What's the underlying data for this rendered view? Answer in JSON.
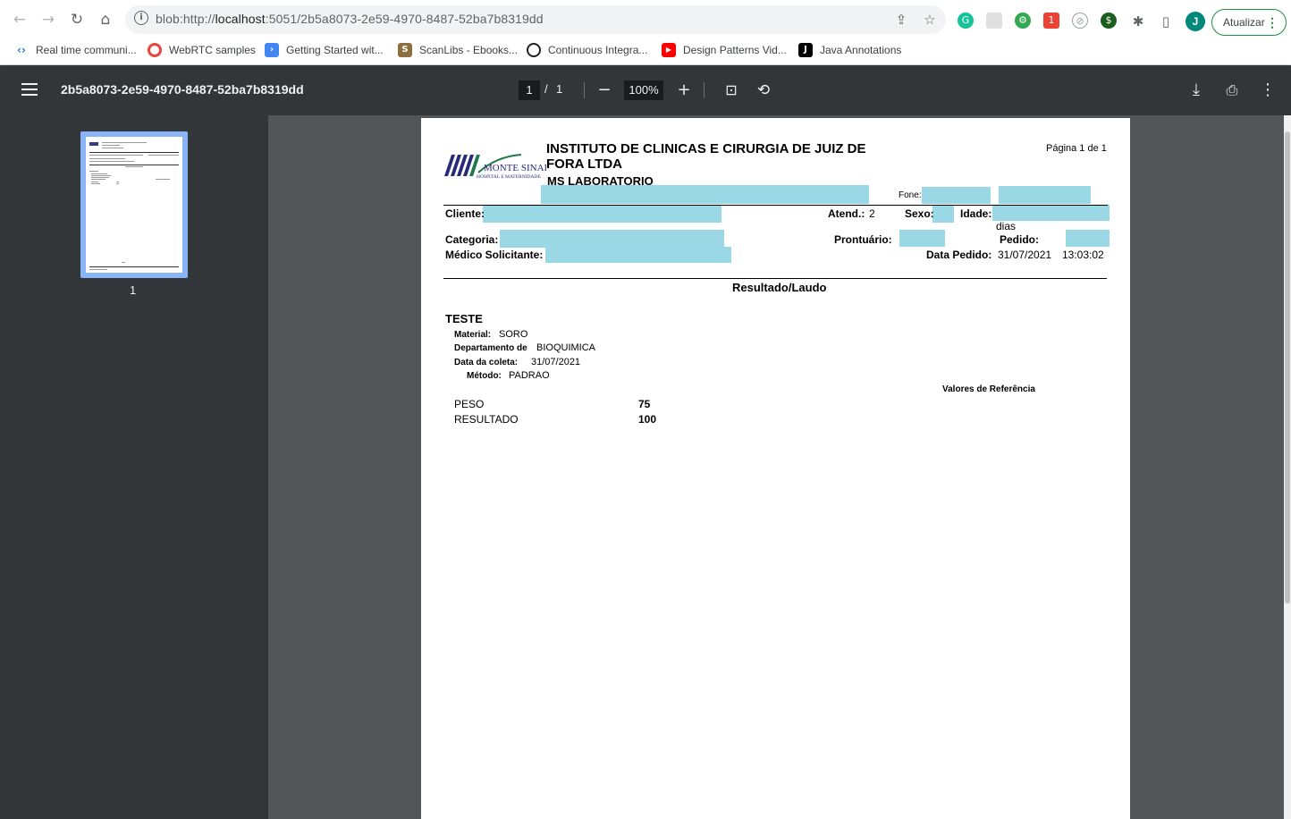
{
  "browser": {
    "url": "blob:http://localhost:5051/2b5a8073-2e59-4970-8487-52ba7b8319dd",
    "url_prefix": "blob:http://",
    "url_host": "localhost",
    "url_rest": ":5051/2b5a8073-2e59-4970-8487-52ba7b8319dd",
    "profile_initial": "J",
    "update_label": "Atualizar",
    "bookmarks": [
      {
        "label": "Real time communi...",
        "icon": "code-icon",
        "color": "#1a73e8"
      },
      {
        "label": "WebRTC samples",
        "icon": "webrtc-icon",
        "color": "#e8453c"
      },
      {
        "label": "Getting Started wit...",
        "icon": "arrow-icon",
        "color": "#4285f4"
      },
      {
        "label": "ScanLibs - Ebooks...",
        "icon": "scanlibs-icon",
        "color": "#8d6e3f"
      },
      {
        "label": "Continuous Integra...",
        "icon": "ci-icon",
        "color": "#202124"
      },
      {
        "label": "Design Patterns Vid...",
        "icon": "youtube-icon",
        "color": "#ff0000"
      },
      {
        "label": "Java Annotations",
        "icon": "j-icon",
        "color": "#000000"
      }
    ]
  },
  "pdf_viewer": {
    "title": "2b5a8073-2e59-4970-8487-52ba7b8319dd",
    "current_page": "1",
    "page_separator": "/",
    "total_pages": "1",
    "zoom": "100%",
    "thumbnail_label": "1"
  },
  "document": {
    "institution_line1": "INSTITUTO DE CLINICAS E CIRURGIA DE JUIZ DE",
    "institution_line2": "FORA LTDA",
    "lab_name": "MS LABORATORIO",
    "page_info": "Página 1 de 1",
    "logo_text_1": "MONTE SINAI",
    "logo_text_2": "HOSPITAL E MATERNIDADE",
    "fone_label": "Fone:",
    "cliente_label": "Cliente:",
    "atend_label": "Atend.:",
    "atend_value": "2",
    "sexo_label": "Sexo:",
    "idade_label": "Idade:",
    "idade_unit": "dias",
    "categoria_label": "Categoria:",
    "prontuario_label": "Prontuário:",
    "pedido_label": "Pedido:",
    "medico_label": "Médico Solicitante:",
    "data_pedido_label": "Data Pedido:",
    "data_pedido_value": "31/07/2021",
    "hora_pedido_value": "13:03:02",
    "section_title": "Resultado/Laudo",
    "exam_name": "TESTE",
    "material_label": "Material:",
    "material_value": "SORO",
    "departamento_label": "Departamento de",
    "departamento_value": "BIOQUIMICA",
    "coleta_label": "Data da coleta:",
    "coleta_value": "31/07/2021",
    "metodo_label": "Método:",
    "metodo_value": "PADRAO",
    "ref_label": "Valores de Referência",
    "results": [
      {
        "name": "PESO",
        "value": "75"
      },
      {
        "name": "RESULTADO",
        "value": "100"
      }
    ]
  },
  "colors": {
    "redaction": "#9bd8e6",
    "toolbar": "#323639",
    "viewer_bg": "#525659"
  }
}
